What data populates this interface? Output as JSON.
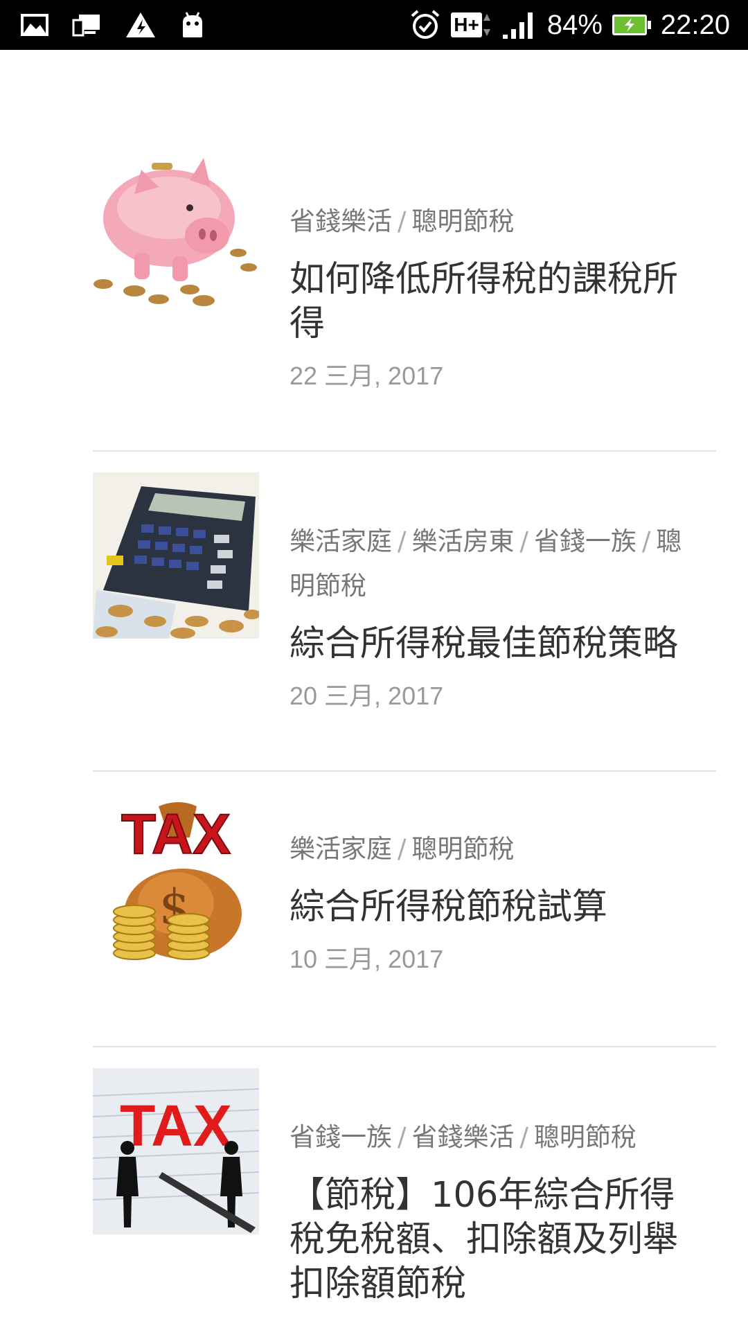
{
  "status_bar": {
    "battery_percent": "84%",
    "time": "22:20",
    "network": "H+"
  },
  "posts": [
    {
      "image": "piggy-bank",
      "categories": [
        "省錢樂活",
        "聰明節稅"
      ],
      "title": "如何降低所得稅的課稅所得",
      "date": "22 三月, 2017"
    },
    {
      "image": "calculator-coins",
      "categories": [
        "樂活家庭",
        "樂活房東",
        "省錢一族",
        "聰明節稅"
      ],
      "title": "綜合所得稅最佳節稅策略",
      "date": "20 三月, 2017"
    },
    {
      "image": "tax-money-bag",
      "image_text": "TAX",
      "categories": [
        "樂活家庭",
        "聰明節稅"
      ],
      "title": "綜合所得稅節稅試算",
      "date": "10 三月, 2017"
    },
    {
      "image": "tax-people-budget",
      "image_text": "TAX",
      "categories": [
        "省錢一族",
        "省錢樂活",
        "聰明節稅"
      ],
      "title": "【節稅】106年綜合所得稅免稅額、扣除額及列舉扣除額節稅",
      "date": ""
    }
  ]
}
